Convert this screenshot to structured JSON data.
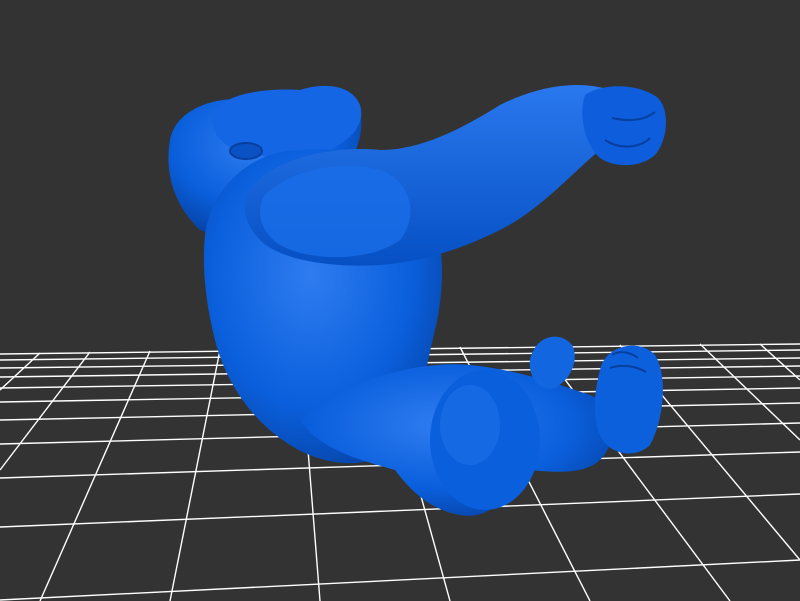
{
  "viewer": {
    "background_color": "#333333",
    "grid_color": "#ffffff",
    "model_color": "#0a5fdc",
    "model_shadow_color": "#063f9e",
    "model_highlight_color": "#2f7cf0",
    "model_subject": "gorilla-figure"
  }
}
